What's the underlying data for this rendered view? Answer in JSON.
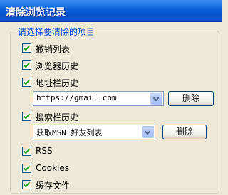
{
  "window": {
    "title": "清除浏览记录"
  },
  "group": {
    "label": "请选择要清除的项目"
  },
  "items": [
    {
      "label": "撤销列表",
      "checked": true
    },
    {
      "label": "浏览器历史",
      "checked": true
    },
    {
      "label": "地址栏历史",
      "checked": true
    },
    {
      "label": "搜索栏历史",
      "checked": true
    },
    {
      "label": "RSS",
      "checked": true
    },
    {
      "label": "Cookies",
      "checked": true
    },
    {
      "label": "缓存文件",
      "checked": true
    }
  ],
  "address_history": {
    "value": "https://gmail.com",
    "delete_label": "删除"
  },
  "search_history": {
    "value": "获取MSN 好友列表",
    "delete_label": "删除"
  }
}
